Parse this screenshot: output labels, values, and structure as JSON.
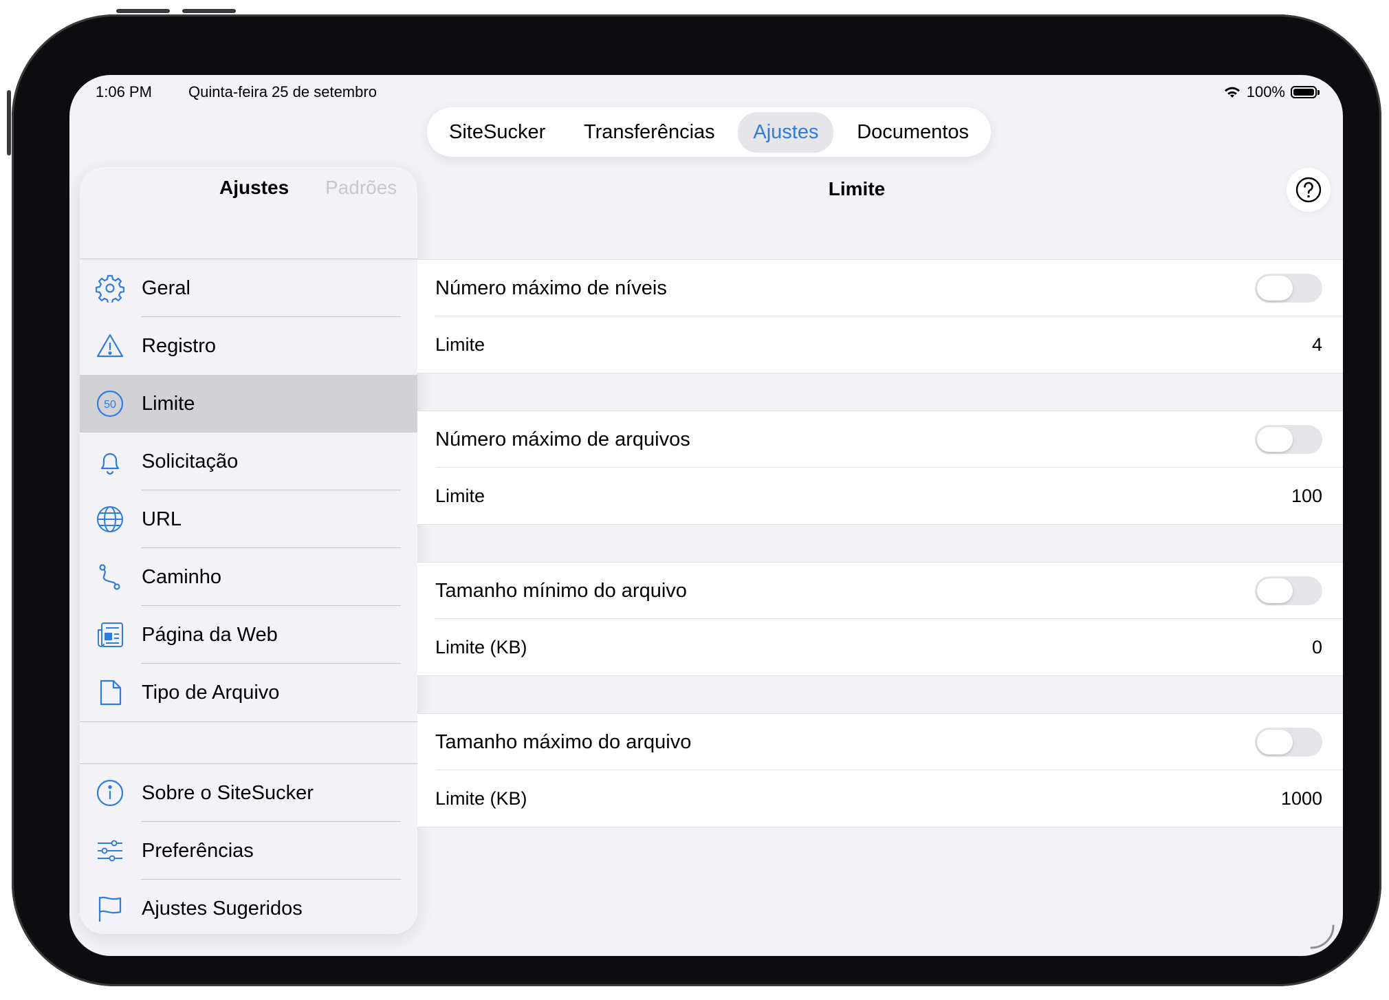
{
  "status_bar": {
    "time": "1:06 PM",
    "date": "Quinta-feira 25 de setembro",
    "battery": "100%",
    "icons": [
      "wifi-icon",
      "battery-icon"
    ]
  },
  "tabbar": {
    "tabs": [
      {
        "label": "SiteSucker",
        "active": false
      },
      {
        "label": "Transferências",
        "active": false
      },
      {
        "label": "Ajustes",
        "active": true
      },
      {
        "label": "Documentos",
        "active": false
      }
    ]
  },
  "sidebar": {
    "title": "Ajustes",
    "padroes": "Padrões",
    "items": [
      {
        "label": "Geral",
        "icon": "gear-icon"
      },
      {
        "label": "Registro",
        "icon": "warning-icon"
      },
      {
        "label": "Limite",
        "icon": "limit-50-icon",
        "selected": true
      },
      {
        "label": "Solicitação",
        "icon": "bell-icon"
      },
      {
        "label": "URL",
        "icon": "globe-icon"
      },
      {
        "label": "Caminho",
        "icon": "path-icon"
      },
      {
        "label": "Página da Web",
        "icon": "newspaper-icon"
      },
      {
        "label": "Tipo de Arquivo",
        "icon": "document-icon"
      }
    ],
    "items2": [
      {
        "label": "Sobre o SiteSucker",
        "icon": "info-icon"
      },
      {
        "label": "Preferências",
        "icon": "sliders-icon"
      },
      {
        "label": "Ajustes Sugeridos",
        "icon": "flag-icon"
      }
    ]
  },
  "detail": {
    "title": "Limite",
    "groups": [
      {
        "toggle_label": "Número máximo de níveis",
        "toggle_on": false,
        "limit_label": "Limite",
        "limit_value": "4"
      },
      {
        "toggle_label": "Número máximo de arquivos",
        "toggle_on": false,
        "limit_label": "Limite",
        "limit_value": "100"
      },
      {
        "toggle_label": "Tamanho mínimo do arquivo",
        "toggle_on": false,
        "limit_label": "Limite (KB)",
        "limit_value": "0"
      },
      {
        "toggle_label": "Tamanho máximo do arquivo",
        "toggle_on": false,
        "limit_label": "Limite (KB)",
        "limit_value": "1000"
      }
    ]
  },
  "colors": {
    "accent": "#2f7cdb",
    "background": "#f2f2f7",
    "selected_row": "#d1d1d6"
  }
}
